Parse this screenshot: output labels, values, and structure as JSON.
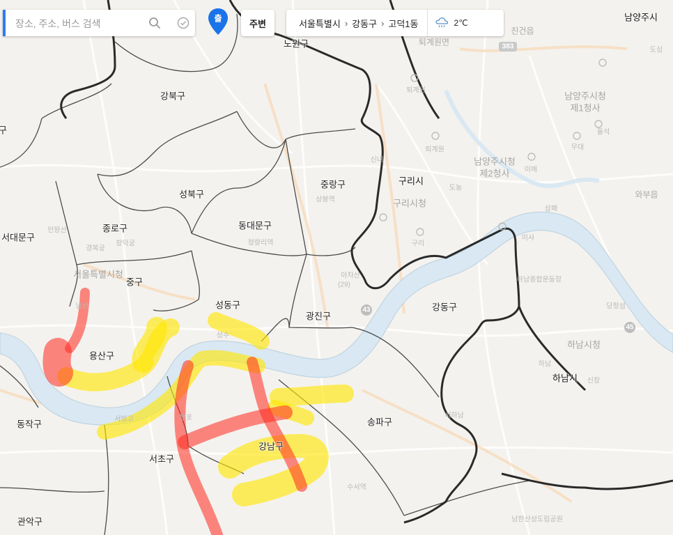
{
  "search": {
    "placeholder": "장소, 주소, 버스 검색"
  },
  "depart_button": {
    "label": "출"
  },
  "nearby_button": {
    "label": "주변"
  },
  "breadcrumb": {
    "items": [
      "서울특별시",
      "강동구",
      "고덕1동"
    ]
  },
  "weather": {
    "temperature": "2℃",
    "icon": "rain-cloud-icon"
  },
  "map_labels": {
    "districts": {
      "nowon": "노원구",
      "gangbuk": "강북구",
      "seongbuk": "성북구",
      "jungnang": "중랑구",
      "dongdaemun": "동대문구",
      "jongno": "종로구",
      "seodaemun": "서대문구",
      "jung": "중구",
      "seongdong": "성동구",
      "gwangjin": "광진구",
      "yongsan": "용산구",
      "gangdong": "강동구",
      "dongjak": "동작구",
      "seocho": "서초구",
      "gangnam": "강남구",
      "songpa": "송파구",
      "gwanak": "관악구",
      "edge_left": "구"
    },
    "cities": {
      "namyangju_city": "남양주시",
      "guri": "구리시",
      "hanam": "하남시"
    },
    "landmarks": {
      "seoul_cityhall": "서울특별시청",
      "guri_cityhall": "구리시청",
      "namyangju_hall1_line1": "남양주시청",
      "namyangju_hall1_line2": "제1청사",
      "namyangju_hall2_line1": "남양주시청",
      "namyangju_hall2_line2": "제2청사",
      "hanam_cityhall": "하남시청",
      "jingeon": "진건읍",
      "wabu": "와부읍",
      "toegyewon_myeon": "퇴계원면",
      "toegyewon": "퇴계원",
      "road_383": "383",
      "road_43": "43",
      "road_45": "45",
      "road_29": "(29)",
      "sangbong": "상봉역",
      "cheongnyangni": "청량리역",
      "inwangsan": "인왕산",
      "gyeongbokgung": "경복궁",
      "changdeokgung": "창덕궁",
      "achasan": "아차산",
      "hanam_sports": "하남종합운동장",
      "dangjeong": "당정섬",
      "suseo": "수서역",
      "namhansanseong": "남한산성도립공원",
      "seongsu": "성수",
      "sinnae": "신내",
      "buyeo": "무대",
      "yulseok": "율석",
      "isu": "이매",
      "miiju": "미사",
      "toegyewon_st": "퇴계원",
      "guri_st": "구리",
      "donong": "도농",
      "sapyeong": "삼패",
      "dosim": "도심",
      "sinjang": "신장",
      "hanam_label": "하남",
      "seohanam": "서하남",
      "namsan": "남산",
      "seobinggo": "서빙고",
      "banpo": "반포"
    }
  },
  "colors": {
    "search_accent": "#2b7cf6",
    "traffic_heavy": "#ff2a1f",
    "traffic_slow": "#ffe600",
    "river": "#d9e8f2",
    "city_border": "#2a2a2a",
    "district_border": "#555555"
  }
}
